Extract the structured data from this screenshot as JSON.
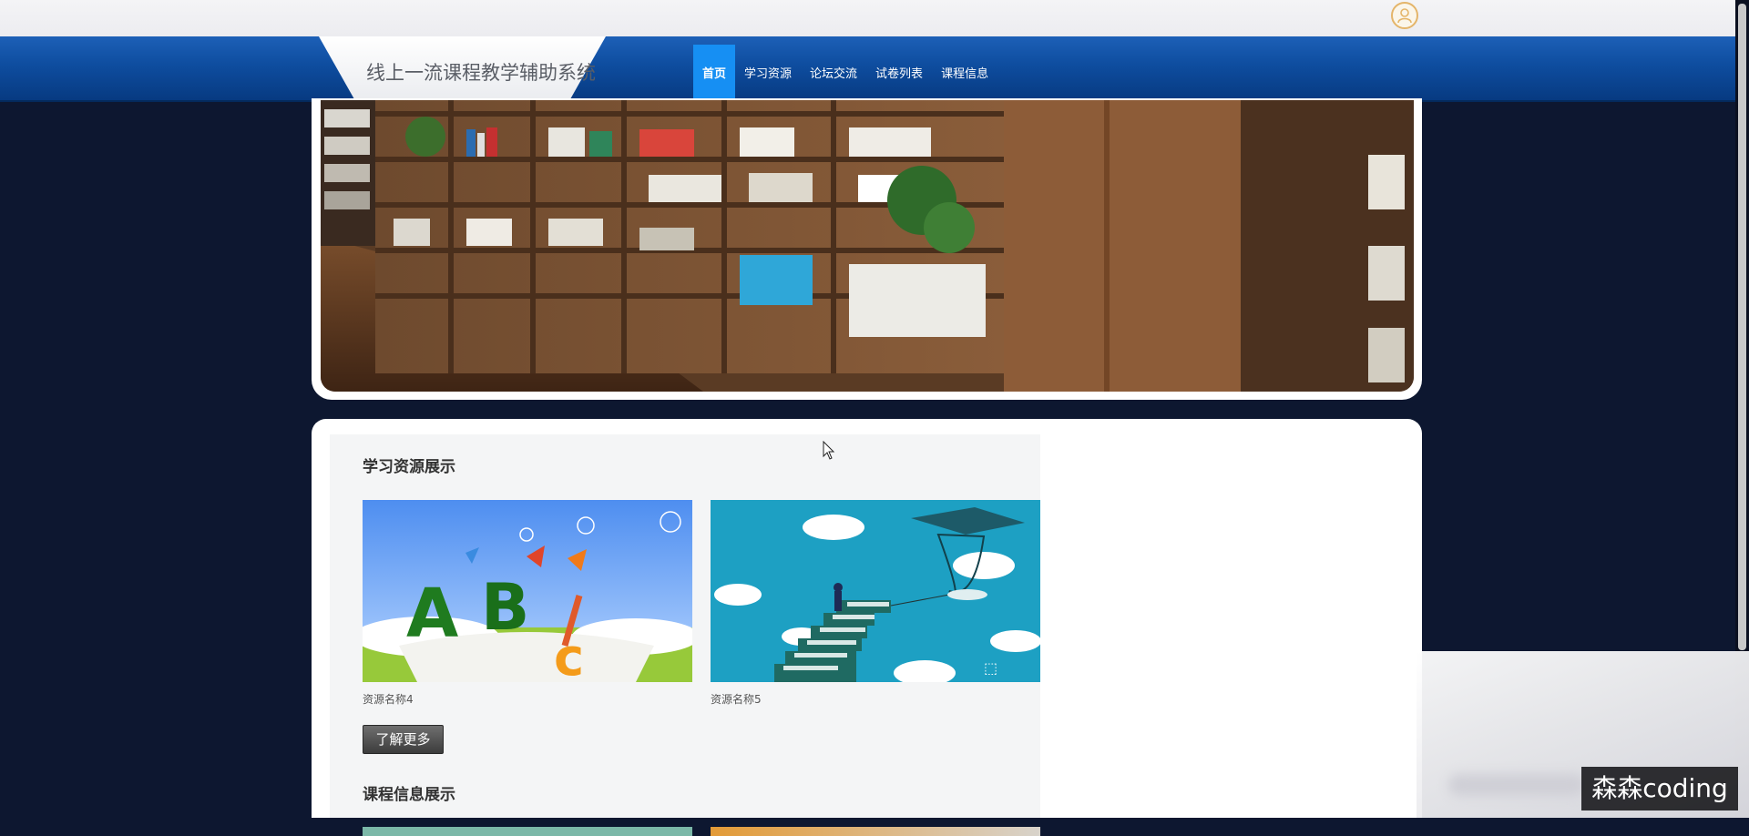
{
  "header": {
    "site_title": "线上一流课程教学辅助系统",
    "user_icon": "user-icon"
  },
  "nav": {
    "items": [
      {
        "label": "首页",
        "active": true
      },
      {
        "label": "学习资源",
        "active": false
      },
      {
        "label": "论坛交流",
        "active": false
      },
      {
        "label": "试卷列表",
        "active": false
      },
      {
        "label": "课程信息",
        "active": false
      }
    ]
  },
  "colors": {
    "nav_blue": "#0e4d9f",
    "nav_active": "#168ff3",
    "page_background": "#0d1730",
    "user_icon_border": "#e4b56a"
  },
  "sections": {
    "resources": {
      "title": "学习资源展示",
      "items": [
        {
          "name": "资源名称4"
        },
        {
          "name": "资源名称5"
        }
      ],
      "more_label": "了解更多"
    },
    "courses": {
      "title": "课程信息展示"
    }
  },
  "watermark": {
    "text": "森森coding"
  }
}
